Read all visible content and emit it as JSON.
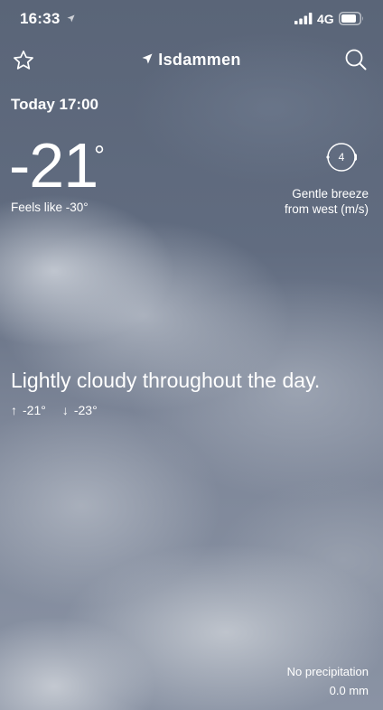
{
  "status_bar": {
    "time": "16:33",
    "network": "4G"
  },
  "header": {
    "location": "Isdammen",
    "star_icon": "star-outline-icon",
    "search_icon": "search-icon",
    "location_icon": "location-arrow-icon"
  },
  "current": {
    "date_time": "Today 17:00",
    "temperature": "-21",
    "unit": "°",
    "feels_like": "Feels like -30°"
  },
  "wind": {
    "speed": "4",
    "description_line1": "Gentle breeze",
    "description_line2": "from west (m/s)"
  },
  "forecast": {
    "summary": "Lightly cloudy throughout the day.",
    "high_arrow": "↑",
    "high": "-21°",
    "low_arrow": "↓",
    "low": "-23°"
  },
  "precipitation": {
    "label": "No precipitation",
    "amount": "0.0 mm"
  },
  "colors": {
    "text": "#ffffff",
    "sky_top": "#5a6578",
    "sky_bottom": "#8a93a4"
  }
}
